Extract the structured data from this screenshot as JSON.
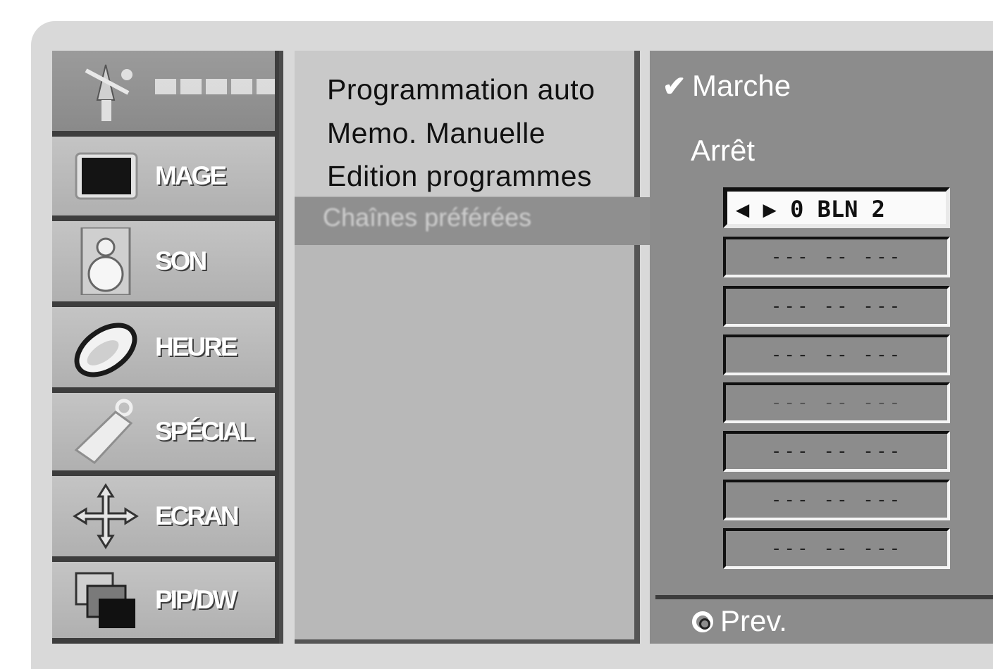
{
  "menu": {
    "setup_label": "",
    "items": [
      {
        "label": "MAGE",
        "icon": "monitor-icon"
      },
      {
        "label": "SON",
        "icon": "speaker-icon"
      },
      {
        "label": "HEURE",
        "icon": "clock-icon"
      },
      {
        "label": "SPÉCIAL",
        "icon": "tag-icon"
      },
      {
        "label": "ECRAN",
        "icon": "move-arrows-icon"
      },
      {
        "label": "PIP/DW",
        "icon": "pip-icon"
      }
    ]
  },
  "submenu": {
    "options": [
      "Programmation auto",
      "Memo. Manuelle",
      "Edition programmes"
    ],
    "selected": "Chaînes préférées"
  },
  "settings": {
    "on_label": "Marche",
    "off_label": "Arrêt",
    "first_slot": "0 BLN 2",
    "empty_slot": "--- -- ---",
    "prev_label": "Prev."
  }
}
